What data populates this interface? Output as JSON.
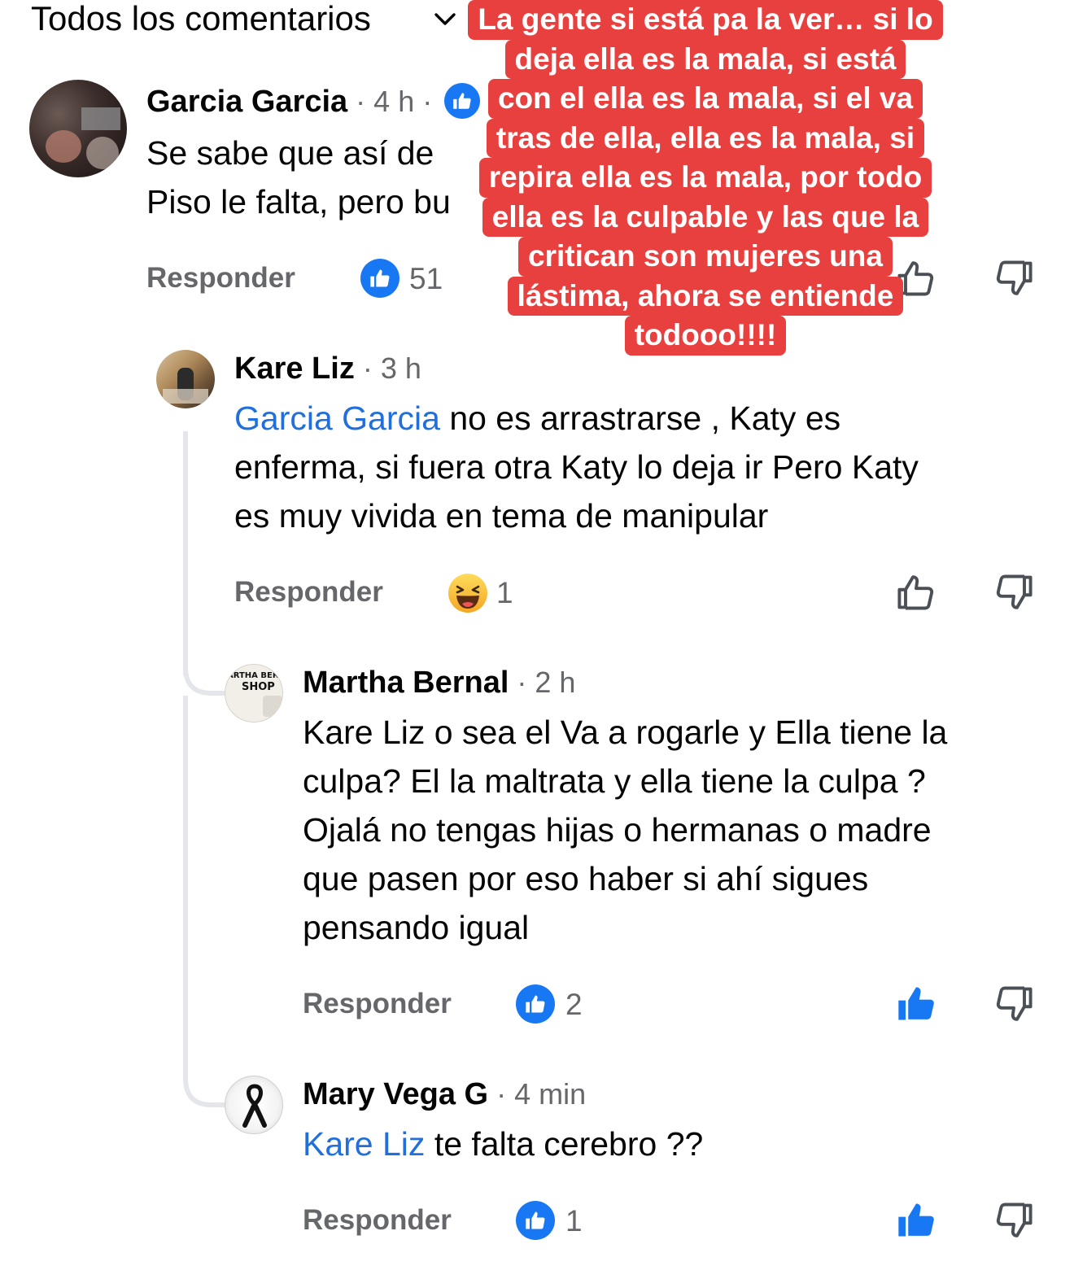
{
  "header": {
    "title": "Todos los comentarios"
  },
  "comments": [
    {
      "author": "Garcia Garcia",
      "time": "4 h",
      "text_line1": "Se sabe que así de",
      "text_line2": "Piso le falta, pero bu",
      "reply_label": "Responder",
      "reaction_count": "51"
    },
    {
      "author": "Kare Liz",
      "time": "3 h",
      "mention": "Garcia Garcia",
      "text_after_mention": " no es arrastrarse , Katy es",
      "text_line2": "enferma, si fuera otra Katy lo deja ir Pero Katy",
      "text_line3": "es muy vivida en tema de manipular",
      "reply_label": "Responder",
      "reaction_count": "1"
    },
    {
      "author": "Martha Bernal",
      "time": "2 h",
      "avatar_text_1": "ARTHA BERN",
      "avatar_text_2": "SHOP",
      "text_lines": [
        "Kare Liz o sea el Va a rogarle y Ella tiene la",
        "culpa?  El la maltrata y ella tiene la culpa ?",
        "Ojalá no tengas hijas o hermanas o madre",
        "que pasen por eso  haber si ahí sigues",
        "pensando igual"
      ],
      "reply_label": "Responder",
      "reaction_count": "2"
    },
    {
      "author": "Mary Vega G",
      "time": "4 min",
      "mention": "Kare Liz",
      "text_after_mention": " te falta cerebro ??",
      "reply_label": "Responder",
      "reaction_count": "1"
    }
  ],
  "overlay_lines": [
    "La gente si está pa la ver… si lo",
    "deja ella es la  mala, si está",
    "con el ella es la mala, si el va",
    "tras de ella, ella es la mala, si",
    "repira ella es la mala, por todo",
    "ella es la culpable y las que la",
    "critican son mujeres una",
    "lástima, ahora se entiende",
    "todooo!!!!"
  ],
  "colors": {
    "mention": "#216fdb",
    "like_blue": "#1877f2",
    "overlay_red": "#e8403f",
    "secondary_text": "#65676b"
  },
  "icons": [
    "chevron-down-icon",
    "like-icon",
    "dislike-icon",
    "haha-emoji-icon"
  ]
}
